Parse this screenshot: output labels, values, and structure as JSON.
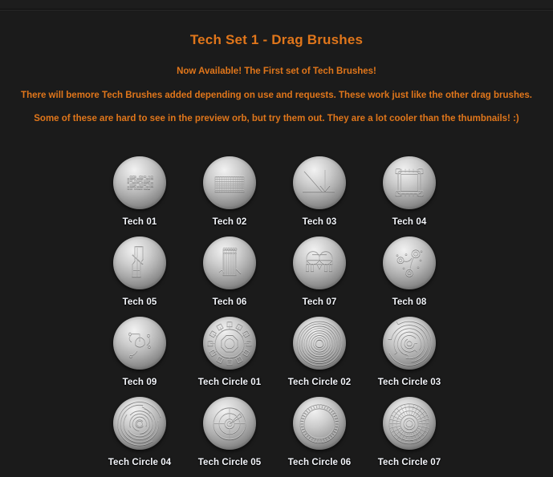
{
  "page": {
    "title": "Tech Set 1 - Drag Brushes",
    "accent_color": "#e0761b",
    "background_color": "#1b1b1b",
    "label_color": "#f4f6fb",
    "description": [
      "Now Available! The First set of Tech Brushes!",
      "There will bemore Tech Brushes added depending on use and requests. These work just like the other drag brushes.",
      "Some of these are hard to see in the preview orb, but try them out. They are a lot cooler than the thumbnails! :)"
    ]
  },
  "brushes": [
    {
      "label": "Tech 01",
      "art": "circuit-block"
    },
    {
      "label": "Tech 02",
      "art": "mesh-rect"
    },
    {
      "label": "Tech 03",
      "art": "diagonal-lines"
    },
    {
      "label": "Tech 04",
      "art": "chip-square"
    },
    {
      "label": "Tech 05",
      "art": "vertical-slab"
    },
    {
      "label": "Tech 06",
      "art": "tower-detail"
    },
    {
      "label": "Tech 07",
      "art": "bridge-frame"
    },
    {
      "label": "Tech 08",
      "art": "node-links"
    },
    {
      "label": "Tech 09",
      "art": "tri-swirl"
    },
    {
      "label": "Tech Circle 01",
      "art": "gear-octagon"
    },
    {
      "label": "Tech Circle 02",
      "art": "concentric-rings"
    },
    {
      "label": "Tech Circle 03",
      "art": "maze-rings"
    },
    {
      "label": "Tech Circle 04",
      "art": "spiral-rings"
    },
    {
      "label": "Tech Circle 05",
      "art": "radar-dial"
    },
    {
      "label": "Tech Circle 06",
      "art": "toothed-disc"
    },
    {
      "label": "Tech Circle 07",
      "art": "hub-grid"
    }
  ]
}
